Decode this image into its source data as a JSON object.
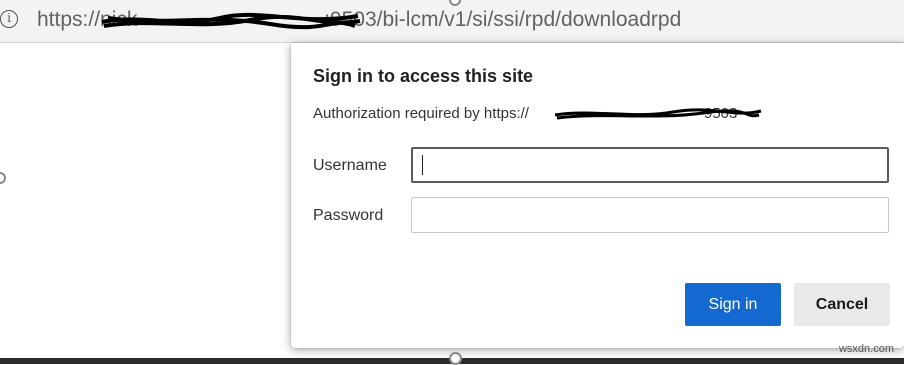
{
  "browser": {
    "url_text": "https://nick                                :9503/bi-lcm/v1/si/ssi/rpd/downloadrpd",
    "info_icon": "i"
  },
  "dialog": {
    "title": "Sign in to access this site",
    "subtitle": "Authorization required by https://                                          9503",
    "username_label": "Username",
    "username_value": "",
    "password_label": "Password",
    "password_value": "",
    "sign_in_label": "Sign in",
    "cancel_label": "Cancel"
  },
  "watermark": "wsxdn.com",
  "colors": {
    "primary_button": "#1469d1",
    "secondary_button": "#e9e9e9"
  }
}
